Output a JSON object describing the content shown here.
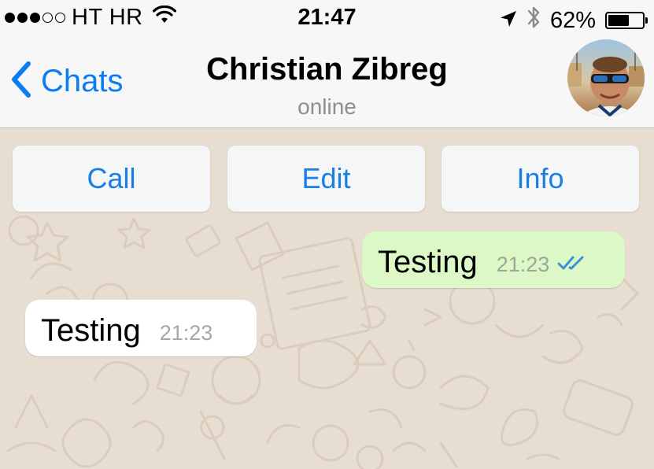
{
  "status_bar": {
    "signal_full": 3,
    "signal_total": 5,
    "carrier": "HT HR",
    "time": "21:47",
    "battery_percent": "62%",
    "battery_level": 0.62,
    "icons": [
      "wifi-icon",
      "location-arrow-icon",
      "bluetooth-icon",
      "battery-icon"
    ]
  },
  "nav": {
    "back_label": "Chats",
    "contact_name": "Christian Zibreg",
    "contact_status": "online"
  },
  "actions": {
    "call_label": "Call",
    "edit_label": "Edit",
    "info_label": "Info"
  },
  "messages": [
    {
      "direction": "outgoing",
      "text": "Testing",
      "time": "21:23",
      "status": "read-double-tick"
    },
    {
      "direction": "incoming",
      "text": "Testing",
      "time": "21:23"
    }
  ],
  "colors": {
    "accent_blue": "#0a7cf4",
    "outgoing_bubble": "#dcf8c6",
    "incoming_bubble": "#ffffff",
    "chat_background": "#e7ddd1",
    "read_tick_blue": "#3b91d8"
  }
}
